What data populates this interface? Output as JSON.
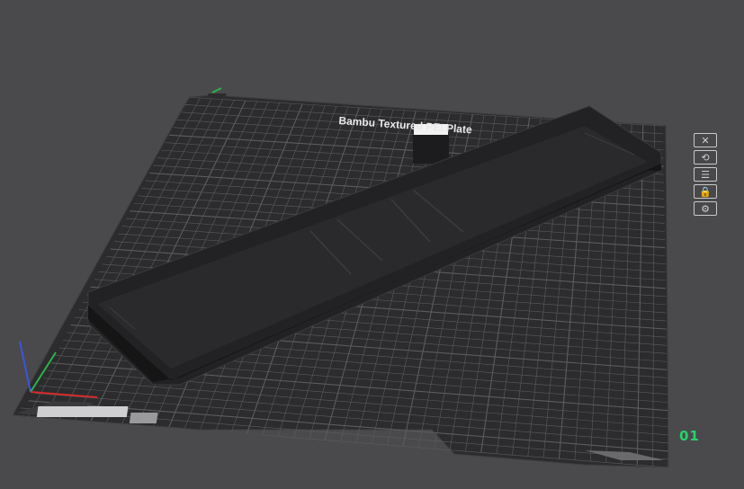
{
  "scene": {
    "background_color": "#4a4a4c",
    "plate_color": "#2c2c2e",
    "grid_color": "#5c5c5f",
    "model_color": "#1c1c1e",
    "plate_label": "Bambu Textured PEI Plate",
    "plate_number": "01",
    "plate_number_color": "#29d16b",
    "axis_colors": {
      "x": "#d42a2a",
      "y": "#2fb24a",
      "z": "#3a55e0"
    }
  },
  "plate_toolbar": [
    {
      "icon": "close-icon",
      "glyph": "✕"
    },
    {
      "icon": "auto-orient-icon",
      "glyph": "⟲"
    },
    {
      "icon": "arrange-icon",
      "glyph": "☰"
    },
    {
      "icon": "lock-icon",
      "glyph": "🔒"
    },
    {
      "icon": "settings-icon",
      "glyph": "⚙"
    }
  ]
}
